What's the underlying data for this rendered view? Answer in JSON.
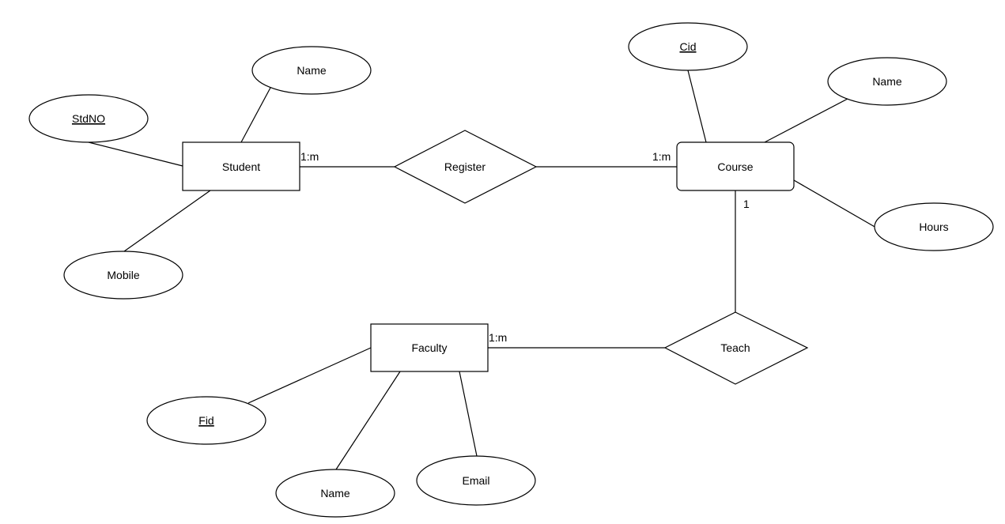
{
  "diagram": {
    "type": "er-diagram",
    "colors": {
      "stroke": "#000000",
      "fill": "#ffffff",
      "text": "#000000"
    },
    "entities": [
      {
        "id": "student",
        "label": "Student",
        "rounded": false
      },
      {
        "id": "course",
        "label": "Course",
        "rounded": true
      },
      {
        "id": "faculty",
        "label": "Faculty",
        "rounded": false
      }
    ],
    "relationships": [
      {
        "id": "register",
        "label": "Register"
      },
      {
        "id": "teach",
        "label": "Teach"
      }
    ],
    "attributes": [
      {
        "id": "student-stdno",
        "entity": "student",
        "label": "StdNO",
        "key": true
      },
      {
        "id": "student-name",
        "entity": "student",
        "label": "Name",
        "key": false
      },
      {
        "id": "student-mobile",
        "entity": "student",
        "label": "Mobile",
        "key": false
      },
      {
        "id": "course-cid",
        "entity": "course",
        "label": "Cid",
        "key": true
      },
      {
        "id": "course-name",
        "entity": "course",
        "label": "Name",
        "key": false
      },
      {
        "id": "course-hours",
        "entity": "course",
        "label": "Hours",
        "key": false
      },
      {
        "id": "faculty-fid",
        "entity": "faculty",
        "label": "Fid",
        "key": true
      },
      {
        "id": "faculty-name",
        "entity": "faculty",
        "label": "Name",
        "key": false
      },
      {
        "id": "faculty-email",
        "entity": "faculty",
        "label": "Email",
        "key": false
      }
    ],
    "connections": [
      {
        "from": "student",
        "to": "register",
        "cardinality": "1:m"
      },
      {
        "from": "register",
        "to": "course",
        "cardinality": "1:m"
      },
      {
        "from": "course",
        "to": "teach",
        "cardinality": "1"
      },
      {
        "from": "faculty",
        "to": "teach",
        "cardinality": "1:m"
      }
    ]
  }
}
